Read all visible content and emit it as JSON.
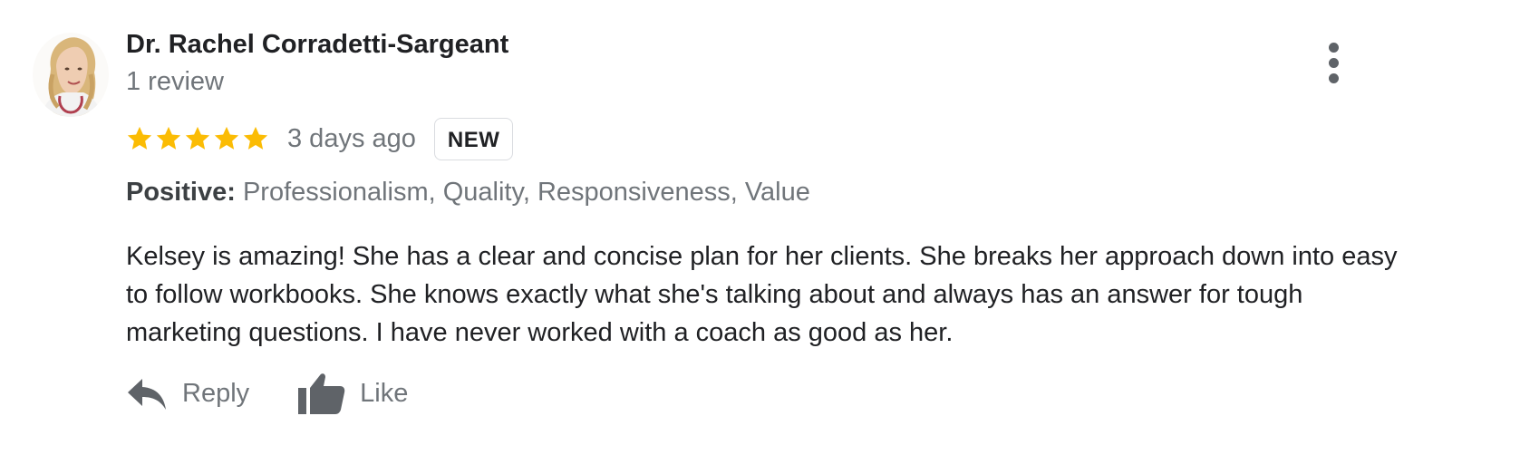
{
  "reviewer": {
    "name": "Dr. Rachel Corradetti-Sargeant",
    "review_count": "1 review",
    "avatar_icon": "reviewer-avatar-photo"
  },
  "review": {
    "rating": 5,
    "max_rating": 5,
    "star_color": "#fbbc04",
    "time": "3 days ago",
    "badge": "NEW",
    "highlights_label": "Positive:",
    "highlights_value": "Professionalism, Quality, Responsiveness, Value",
    "text": "Kelsey is amazing! She has a clear and concise plan for her clients. She breaks her approach down into easy to follow workbooks. She knows exactly what she's talking about and always has an answer for tough marketing questions. I have never worked with a coach as good as her."
  },
  "actions": {
    "reply_label": "Reply",
    "reply_icon": "reply-arrow-icon",
    "like_label": "Like",
    "like_icon": "thumbs-up-icon"
  },
  "menu": {
    "icon": "more-vert-icon"
  }
}
